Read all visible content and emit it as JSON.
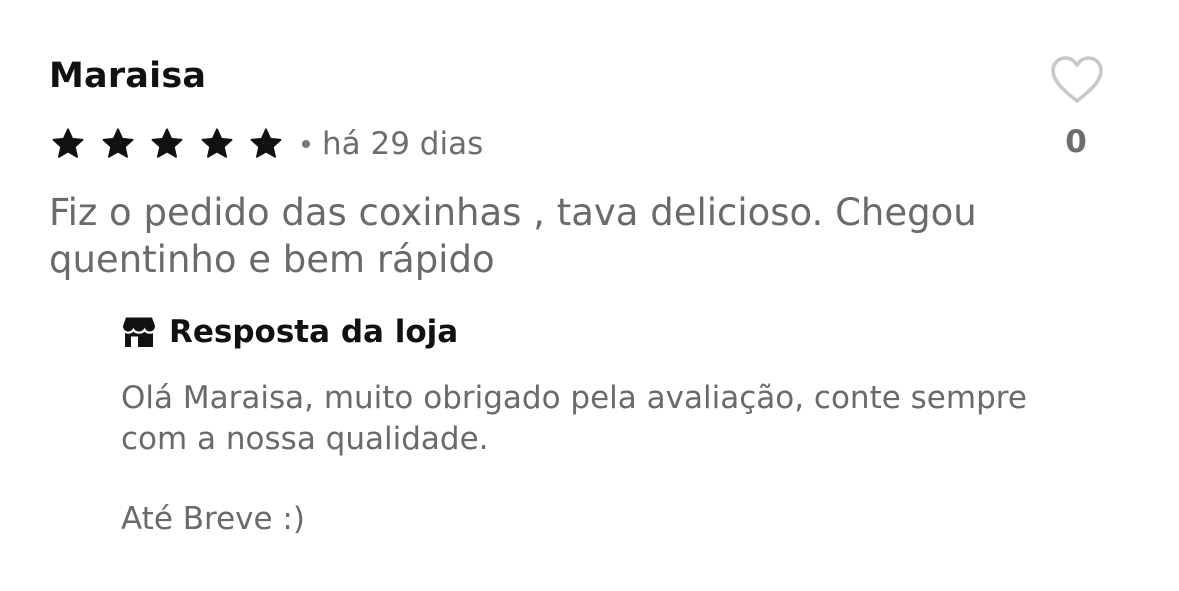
{
  "review": {
    "author": "Maraisa",
    "rating": 5,
    "rating_max": 5,
    "date": "há 29 dias",
    "text": "Fiz o pedido das coxinhas , tava delicioso. Chegou quentinho e bem rápido",
    "like_count": "0",
    "icons": {
      "star": "star-icon",
      "like": "heart-outline-icon"
    },
    "colors": {
      "star": "#111111",
      "heart": "#c8c8c8"
    }
  },
  "reply": {
    "title": "Resposta da loja",
    "text": "Olá Maraisa, muito obrigado pela avaliação, conte sempre com a nossa qualidade.",
    "closing": "Até Breve :)",
    "icon": "store-icon"
  }
}
